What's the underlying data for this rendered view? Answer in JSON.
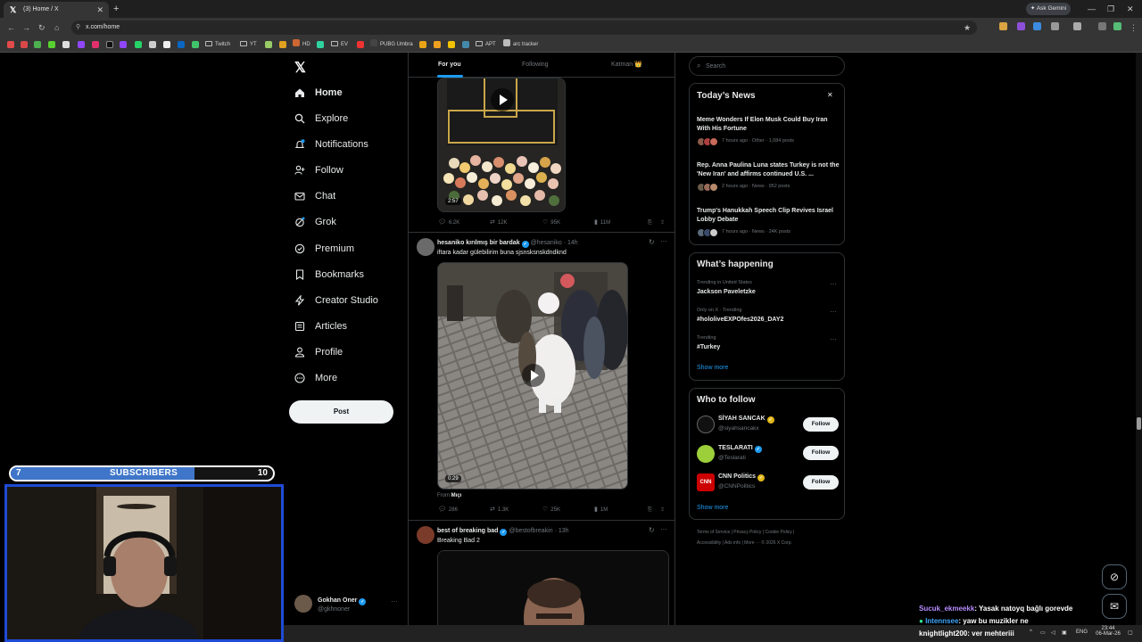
{
  "browser": {
    "tab_title": "(3) Home / X",
    "url": "x.com/home",
    "ask_gemini": "Ask Gemini",
    "bookmarks": [
      {
        "label": "Twitch",
        "type": "folder"
      },
      {
        "label": "YT",
        "type": "folder"
      },
      {
        "label": "HD",
        "type": "link"
      },
      {
        "label": "EV",
        "type": "folder"
      },
      {
        "label": "PUBG Umbra",
        "type": "link"
      },
      {
        "label": "APT",
        "type": "folder"
      },
      {
        "label": "arc tracker",
        "type": "link"
      }
    ]
  },
  "sidebar": {
    "items": [
      {
        "label": "Home",
        "icon": "home-icon"
      },
      {
        "label": "Explore",
        "icon": "search-icon"
      },
      {
        "label": "Notifications",
        "icon": "bell-icon"
      },
      {
        "label": "Follow",
        "icon": "person-add-icon"
      },
      {
        "label": "Chat",
        "icon": "mail-icon"
      },
      {
        "label": "Grok",
        "icon": "grok-icon"
      },
      {
        "label": "Premium",
        "icon": "verified-icon"
      },
      {
        "label": "Bookmarks",
        "icon": "bookmark-icon"
      },
      {
        "label": "Creator Studio",
        "icon": "lightning-icon"
      },
      {
        "label": "Articles",
        "icon": "article-icon"
      },
      {
        "label": "Profile",
        "icon": "person-icon"
      },
      {
        "label": "More",
        "icon": "more-circle-icon"
      }
    ],
    "post_button": "Post",
    "profile": {
      "name": "Gokhan Oner",
      "handle": "@gkhnoner"
    }
  },
  "feed": {
    "tabs": [
      {
        "label": "For you",
        "active": true
      },
      {
        "label": "Following",
        "active": false
      },
      {
        "label": "Katman 👑",
        "active": false
      }
    ],
    "posts": [
      {
        "duration": "2:57",
        "stats": {
          "replies": "6.2K",
          "reposts": "12K",
          "likes": "95K",
          "views": "11M"
        }
      },
      {
        "name": "hesaniko kırılmış bir bardak",
        "handle": "@hesaniko",
        "time": "· 14h",
        "text": "iftara kadar gülebilirim buna sjsnsksnskdndknd",
        "duration": "0:29",
        "from_label": "From",
        "from_user": "Mıçı",
        "stats": {
          "replies": "286",
          "reposts": "1.3K",
          "likes": "25K",
          "views": "1M"
        }
      },
      {
        "name": "best of breaking bad",
        "handle": "@bestofbreakin",
        "time": "· 13h",
        "text": "Breaking Bad 2"
      }
    ]
  },
  "right": {
    "search_placeholder": "Search",
    "todays_news": {
      "title": "Today’s News",
      "items": [
        {
          "headline": "Meme Wonders If Elon Musk Could Buy Iran With His Fortune",
          "meta": "7 hours ago · Other · 1,084 posts"
        },
        {
          "headline": "Rep. Anna Paulina Luna states Turkey is not the 'New Iran' and affirms continued U.S. ...",
          "meta": "2 hours ago · News · 952 posts"
        },
        {
          "headline": "Trump's Hanukkah Speech Clip Revives Israel Lobby Debate",
          "meta": "7 hours ago · News · 24K posts"
        }
      ]
    },
    "whats_happening": {
      "title": "What’s happening",
      "items": [
        {
          "meta": "Trending in United States",
          "topic": "Jackson Paveletzke"
        },
        {
          "meta": "Only on X · Trending",
          "topic": "#hololiveEXPOfes2026_DAY2"
        },
        {
          "meta": "Trending",
          "topic": "#Turkey"
        }
      ],
      "show_more": "Show more"
    },
    "who_to_follow": {
      "title": "Who to follow",
      "items": [
        {
          "name": "SİYAH SANCAK",
          "handle": "@siyahsancakx",
          "badge": "gold",
          "button": "Follow"
        },
        {
          "name": "TESLARATI",
          "handle": "@Teslarati",
          "badge": "blue",
          "button": "Follow"
        },
        {
          "name": "CNN Politics",
          "handle": "@CNNPolitics",
          "badge": "gold",
          "button": "Follow",
          "avatar_text": "CNN"
        }
      ],
      "show_more": "Show more"
    },
    "footer": {
      "line1": "Terms of Service  |  Privacy Policy  |  Cookie Policy  |",
      "line2": "Accessibility  |  Ads info  |  More ···  © 2026 X Corp."
    }
  },
  "overlay": {
    "subscribers": {
      "label": "SUBSCRIBERS",
      "current": "7",
      "goal": "10",
      "progress": 0.7
    },
    "chat": [
      {
        "user": "Sucuk_ekmeekk",
        "user_color": "#b68cff",
        "text": ": Yasak natoyq bağlı gorevde"
      },
      {
        "user": "Intennsee",
        "user_color": "#3ea8ff",
        "text": ": yaw bu muzikler ne"
      },
      {
        "user": "knightlight200",
        "user_color": "#ffffff",
        "text": ": ver mehteriii"
      }
    ]
  },
  "taskbar": {
    "lang": "ENG",
    "time": "23:44",
    "date": "06-Mar-26"
  },
  "colors": {
    "accent": "#1d9bf0",
    "background": "#000000",
    "border": "#2f3336",
    "muted": "#71767b",
    "webcam_border": "#1f4bd6",
    "sub_fill": "#3f76c9"
  }
}
